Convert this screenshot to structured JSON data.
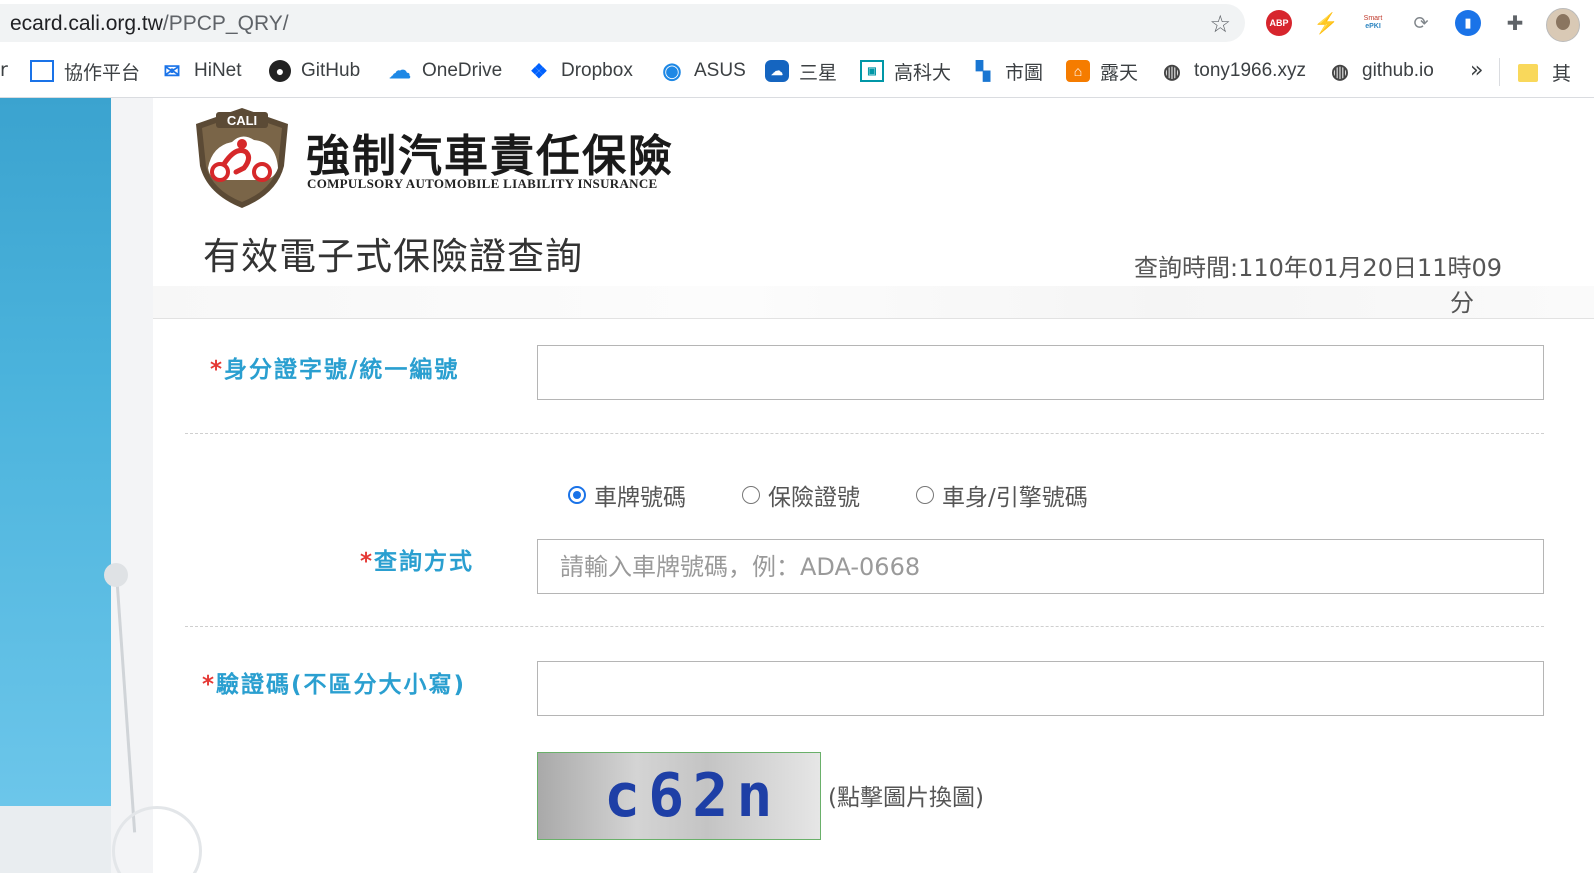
{
  "browser": {
    "url_host": "ecard.cali.org.tw",
    "url_path": "/PPCP_QRY/",
    "extensions": {
      "abp_label": "ABP",
      "pki_label_top": "Smart",
      "pki_label_bottom": "ePKI"
    },
    "bookmarks": {
      "cut_label": "r",
      "items": [
        {
          "label": "協作平台",
          "icon": "grid-icon"
        },
        {
          "label": "HiNet",
          "icon": "mail-icon"
        },
        {
          "label": "GitHub",
          "icon": "github-icon"
        },
        {
          "label": "OneDrive",
          "icon": "cloud-icon"
        },
        {
          "label": "Dropbox",
          "icon": "dropbox-icon"
        },
        {
          "label": "ASUS",
          "icon": "asus-icon"
        },
        {
          "label": "三星",
          "icon": "samsung-icon"
        },
        {
          "label": "高科大",
          "icon": "nkust-icon"
        },
        {
          "label": "市圖",
          "icon": "library-icon"
        },
        {
          "label": "露天",
          "icon": "ruten-icon"
        },
        {
          "label": "tony1966.xyz",
          "icon": "globe-icon"
        },
        {
          "label": "github.io",
          "icon": "globe-icon"
        }
      ],
      "more": "»",
      "folder_label": "其"
    }
  },
  "header": {
    "logo_badge": "CALI",
    "logo_title": "強制汽車責任保險",
    "logo_subtitle": "COMPULSORY AUTOMOBILE LIABILITY INSURANCE",
    "page_title": "有效電子式保險證查詢",
    "query_time_line1": "查詢時間:110年01月20日11時09",
    "query_time_line2": "分"
  },
  "form": {
    "required_mark": "*",
    "id_label": "身分證字號/統一編號",
    "id_value": "",
    "query_method_label": "查詢方式",
    "query_options": [
      {
        "label": "車牌號碼",
        "checked": true
      },
      {
        "label": "保險證號",
        "checked": false
      },
      {
        "label": "車身/引擎號碼",
        "checked": false
      }
    ],
    "query_placeholder": "請輸入車牌號碼，例：ADA-0668",
    "captcha_label": "驗證碼(不區分大小寫)",
    "captcha_value": "",
    "captcha_text": "c62n",
    "captcha_hint": "(點擊圖片換圖)"
  },
  "colors": {
    "label_blue": "#2a9fd0",
    "required_red": "#e53935",
    "radio_blue": "#1a73e8",
    "captcha_text": "#1e3fa6"
  }
}
